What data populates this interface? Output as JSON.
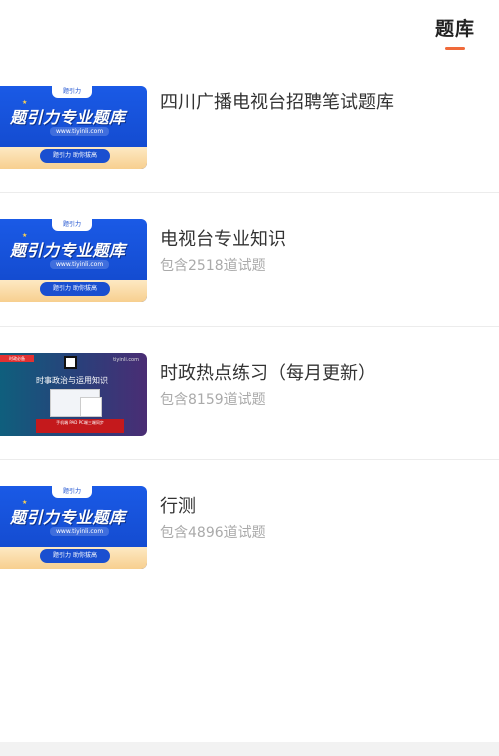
{
  "header": {
    "active_tab": "题库"
  },
  "items": [
    {
      "title": "四川广播电视台招聘笔试题库",
      "subtitle": "",
      "thumb": {
        "style": "blue",
        "logo": "题引力",
        "big": "题引力专业题库",
        "url": "www.tiyinli.com",
        "pill": "题引力 助你拔高"
      }
    },
    {
      "title": "电视台专业知识",
      "subtitle": "包含2518道试题",
      "thumb": {
        "style": "blue",
        "logo": "题引力",
        "big": "题引力专业题库",
        "url": "www.tiyinli.com",
        "pill": "题引力 助你拔高"
      }
    },
    {
      "title": "时政热点练习（每月更新）",
      "subtitle": "包含8159道试题",
      "thumb": {
        "style": "dark",
        "tag": "时政必备",
        "site": "tiyinli.com",
        "headline": "时事政治与运用知识",
        "redbar": "手机端 PAD PC端三端同步"
      }
    },
    {
      "title": "行测",
      "subtitle": "包含4896道试题",
      "thumb": {
        "style": "blue",
        "logo": "题引力",
        "big": "题引力专业题库",
        "url": "www.tiyinli.com",
        "pill": "题引力 助你拔高"
      }
    }
  ],
  "colors": {
    "accent": "#f06a3a",
    "banner_blue": "#1a5ae6",
    "subtitle": "#aaaaaa"
  }
}
